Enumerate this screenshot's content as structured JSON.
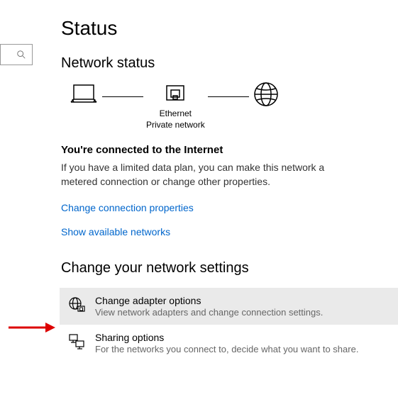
{
  "page": {
    "title": "Status"
  },
  "search": {
    "placeholder": ""
  },
  "network_status": {
    "section_title": "Network status",
    "diagram": {
      "connection_name": "Ethernet",
      "connection_type": "Private network"
    },
    "heading": "You're connected to the Internet",
    "description": "If you have a limited data plan, you can make this network a metered connection or change other properties.",
    "link_connection_properties": "Change connection properties",
    "link_available_networks": "Show available networks"
  },
  "change_settings": {
    "section_title": "Change your network settings",
    "options": [
      {
        "title": "Change adapter options",
        "description": "View network adapters and change connection settings."
      },
      {
        "title": "Sharing options",
        "description": "For the networks you connect to, decide what you want to share."
      }
    ]
  }
}
